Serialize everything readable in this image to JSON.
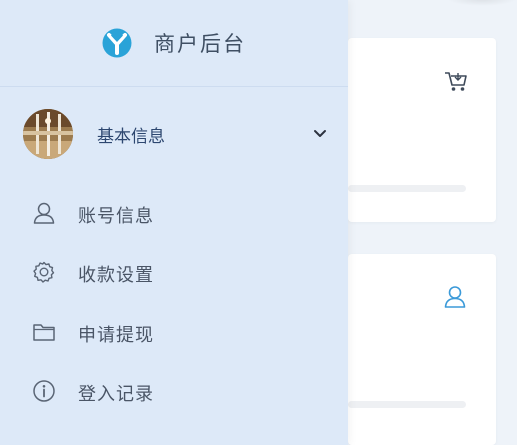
{
  "header": {
    "logo_icon": "y-logo-icon",
    "title": "商户后台",
    "brand_color": "#2aa3d8"
  },
  "user": {
    "avatar_icon": "avatar-image",
    "name": "基本信息",
    "expand_icon": "chevron-down-icon"
  },
  "menu": {
    "items": [
      {
        "icon": "user-icon",
        "label": "账号信息"
      },
      {
        "icon": "gear-icon",
        "label": "收款设置"
      },
      {
        "icon": "folder-icon",
        "label": "申请提现"
      },
      {
        "icon": "info-icon",
        "label": "登入记录"
      }
    ]
  },
  "cards": [
    {
      "icon": "cart-icon"
    },
    {
      "icon": "user-icon"
    }
  ],
  "colors": {
    "sidebar_bg": "#dde9f8",
    "page_bg": "#eef3f9",
    "accent": "#3b9ad9"
  }
}
